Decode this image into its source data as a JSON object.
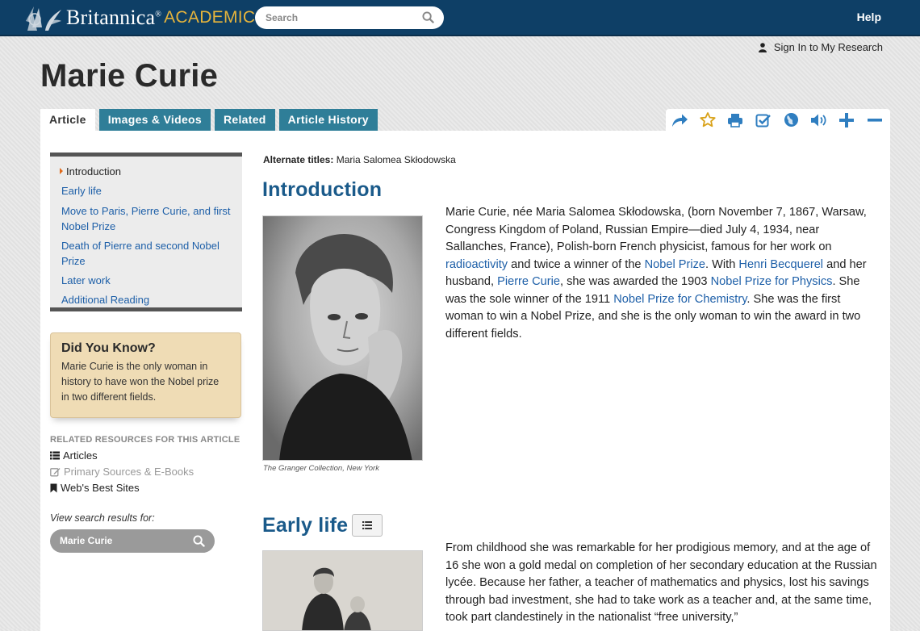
{
  "brand": {
    "name": "Britannica",
    "reg": "®",
    "sub": "ACADEMIC"
  },
  "search": {
    "placeholder": "Search"
  },
  "nav": {
    "help": "Help",
    "signin": "Sign In to My Research"
  },
  "article": {
    "title": "Marie Curie",
    "alternate_label": "Alternate titles:",
    "alternate_value": "Maria Salomea Skłodowska"
  },
  "tabs": [
    {
      "label": "Article",
      "active": true
    },
    {
      "label": "Images & Videos",
      "active": false
    },
    {
      "label": "Related",
      "active": false
    },
    {
      "label": "Article History",
      "active": false
    }
  ],
  "toolbar_icons": [
    "share-icon",
    "star-icon",
    "print-icon",
    "checklist-icon",
    "globe-icon",
    "speaker-icon",
    "zoom-in-icon",
    "zoom-out-icon"
  ],
  "toc": [
    "Introduction",
    "Early life",
    "Move to Paris, Pierre Curie, and first Nobel Prize",
    "Death of Pierre and second Nobel Prize",
    "Later work",
    "Additional Reading"
  ],
  "did_you_know": {
    "title": "Did You Know?",
    "text": "Marie Curie is the only woman in history to have won the Nobel prize in two different fields."
  },
  "related": {
    "heading": "RELATED RESOURCES FOR THIS ARTICLE",
    "items": [
      "Articles",
      "Primary Sources & E-Books",
      "Web's Best Sites"
    ]
  },
  "view_search": {
    "label": "View search results for:",
    "term": "Marie Curie"
  },
  "sections": {
    "intro_heading": "Introduction",
    "intro_caption": "The Granger Collection, New York",
    "intro": {
      "t1": "Marie Curie, née Maria Salomea Skłodowska,  (born November 7, 1867, Warsaw, Congress Kingdom of Poland, Russian Empire—died July 4, 1934, near Sallanches, France), Polish-born French physicist, famous for her work on ",
      "l1": "radioactivity",
      "t2": " and twice a winner of the ",
      "l2": "Nobel Prize",
      "t3": ". With ",
      "l3": "Henri Becquerel",
      "t4": " and her husband, ",
      "l4": "Pierre Curie",
      "t5": ", she was awarded the 1903 ",
      "l5": "Nobel Prize for Physics",
      "t6": ". She was the sole winner of the 1911 ",
      "l6": "Nobel Prize for Chemistry",
      "t7": ". She was the first woman to win a Nobel Prize, and she is the only woman to win the award in two different fields."
    },
    "early_heading": "Early life",
    "early_text": "From childhood she was remarkable for her prodigious memory, and at the age of 16 she won a gold medal on completion of her secondary education at the Russian lycée. Because her father, a teacher of mathematics and physics, lost his savings through bad investment, she had to take work as a teacher and, at the same time, took part clandestinely in the nationalist “free university,”"
  },
  "colors": {
    "header": "#0e3f66",
    "tab": "#2f7e98",
    "link": "#1d5fa8",
    "heading": "#1a5a8a",
    "accent": "#e6b43c"
  }
}
